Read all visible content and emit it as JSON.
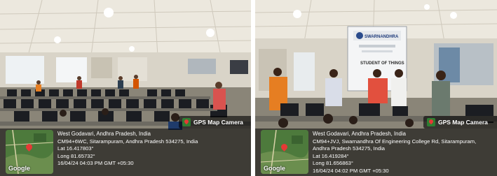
{
  "panels": [
    {
      "badge": "GPS Map Camera",
      "map_brand": "Google",
      "location": "West Godavari, Andhra Pradesh, India",
      "address": "CM94+6WC, Sitarampuram, Andhra Pradesh 534275, India",
      "lat": "Lat 16.417803°",
      "long": "Long 81.65732°",
      "datetime": "16/04/24 04:03 PM GMT +05:30"
    },
    {
      "badge": "GPS Map Camera",
      "map_brand": "Google",
      "location": "West Godavari, Andhra Pradesh, India",
      "address": "CM94+JVJ, Swarnandhra Of Engineering College Rd, Sitarampuram, Andhra Pradesh 534275, India",
      "lat": "Lat 16.419284°",
      "long": "Long 81.656863°",
      "datetime": "16/04/24 04:02 PM GMT +05:30"
    }
  ],
  "screen": {
    "brand": "SWARNANDHRA",
    "caption": "STUDENT OF THINGS"
  },
  "colors": {
    "ceiling": "#ece8de",
    "wall": "#d9d4c8",
    "floor": "#8a8578",
    "monitor": "#1b1d22",
    "overlay": "rgba(0,0,0,0.55)",
    "gps_badge_green": "#2e7d32"
  }
}
